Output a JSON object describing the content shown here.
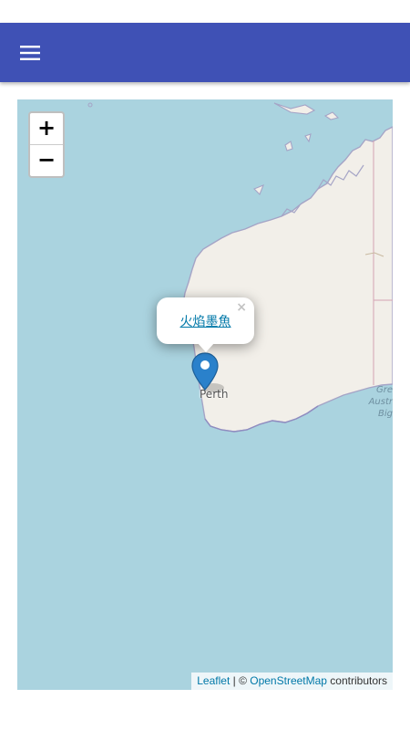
{
  "app_bar": {
    "menu_icon": "hamburger-menu-icon",
    "color": "#3f51b5"
  },
  "map": {
    "water_color": "#aad3df",
    "land_color": "#f2efe9",
    "zoom": {
      "in_label": "+",
      "out_label": "−"
    },
    "popup": {
      "link_text": "火焰墨魚",
      "close_label": "×"
    },
    "marker": {
      "icon": "map-pin-icon",
      "color": "#2a81cb"
    },
    "labels": {
      "city": "Perth",
      "region_lines": [
        "Gre",
        "Austr",
        "Big"
      ]
    },
    "attribution": {
      "leaflet": "Leaflet",
      "separator": " | © ",
      "osm": "OpenStreetMap",
      "contributors": " contributors"
    }
  }
}
